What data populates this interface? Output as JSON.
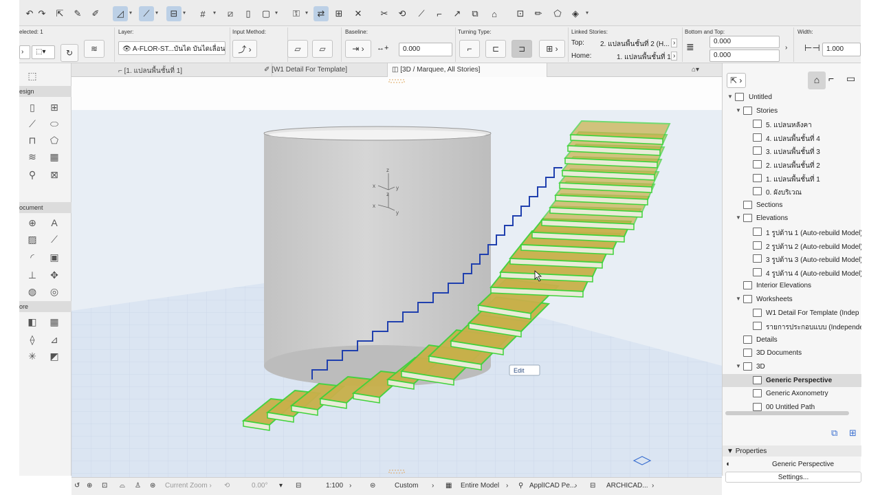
{
  "toolbar": {
    "icons": [
      "undo-icon",
      "redo-icon",
      "pick-icon",
      "eyedropper-icon",
      "inject-icon",
      "snap-guide-icon",
      "guide-line-icon",
      "gravity-icon",
      "grid-snap-icon",
      "trace-icon",
      "magic-wand-icon",
      "suspend-groups-icon",
      "lock-icon",
      "select-3d-icon",
      "cut-plane-icon",
      "orbit-icon",
      "trim-icon",
      "split-icon",
      "adjust-icon",
      "intersect-icon",
      "offset-icon",
      "resize-icon",
      "roof-icon",
      "layout-icon",
      "paint-icon",
      "section-icon",
      "explode-icon"
    ]
  },
  "infobox": {
    "selected_label": "elected: 1",
    "layer_label": "Layer:",
    "layer_value": "A-FLOR-ST...บันได บันไดเลื่อน",
    "input_method_label": "Input Method:",
    "baseline_label": "Baseline:",
    "baseline_value": "0.000",
    "turning_type_label": "Turning Type:",
    "linked_stories_label": "Linked Stories:",
    "top_label": "Top:",
    "top_value": "2. แปลนพื้นชั้นที่ 2 (H...",
    "home_label": "Home:",
    "home_value": "1. แปลนพื้นชั้นที่ 1",
    "bottom_top_label": "Bottom and Top:",
    "bottom_value": "0.000",
    "top_offset_value": "0.000",
    "width_label": "Width:",
    "width_value": "1.000"
  },
  "toolbox": {
    "sections": [
      "esign",
      "ocument",
      "ore"
    ]
  },
  "tabs": [
    {
      "label": "[1. แปลนพื้นชั้นที่ 1]"
    },
    {
      "label": "[W1 Detail For Template]"
    },
    {
      "label": "[3D / Marquee, All Stories]"
    }
  ],
  "viewport": {
    "edit_label": "Edit",
    "axis_labels": [
      "z",
      "x",
      "y",
      "z",
      "x",
      "y"
    ]
  },
  "navigator": {
    "root": "Untitled",
    "items": [
      {
        "label": "Stories",
        "level": 1
      },
      {
        "label": "5. แปลนหลังคา",
        "level": 2
      },
      {
        "label": "4. แปลนพื้นชั้นที่ 4",
        "level": 2
      },
      {
        "label": "3. แปลนพื้นชั้นที่ 3",
        "level": 2
      },
      {
        "label": "2. แปลนพื้นชั้นที่ 2",
        "level": 2
      },
      {
        "label": "1. แปลนพื้นชั้นที่ 1",
        "level": 2
      },
      {
        "label": "0. ผังบริเวณ",
        "level": 2
      },
      {
        "label": "Sections",
        "level": 1
      },
      {
        "label": "Elevations",
        "level": 1
      },
      {
        "label": "1 รูปด้าน 1 (Auto-rebuild Model)",
        "level": 2
      },
      {
        "label": "2 รูปด้าน 2 (Auto-rebuild Model)",
        "level": 2
      },
      {
        "label": "3 รูปด้าน 3 (Auto-rebuild Model)",
        "level": 2
      },
      {
        "label": "4 รูปด้าน 4 (Auto-rebuild Model)",
        "level": 2
      },
      {
        "label": "Interior Elevations",
        "level": 1
      },
      {
        "label": "Worksheets",
        "level": 1
      },
      {
        "label": "W1 Detail For Template (Indep",
        "level": 2
      },
      {
        "label": "รายการประกอบแบบ (Independe",
        "level": 2
      },
      {
        "label": "Details",
        "level": 1
      },
      {
        "label": "3D Documents",
        "level": 1
      },
      {
        "label": "3D",
        "level": 1
      },
      {
        "label": "Generic Perspective",
        "level": 2
      },
      {
        "label": "Generic Axonometry",
        "level": 2
      },
      {
        "label": "00 Untitled Path",
        "level": 2
      }
    ],
    "properties_label": "Properties",
    "properties_value": "Generic Perspective",
    "settings_label": "Settings..."
  },
  "statusbar": {
    "zoom_label": "Current Zoom",
    "angle_value": "0.00°",
    "scale_value": "1:100",
    "pen_set": "Custom",
    "model_filter": "Entire Model",
    "renovation": "ApplICAD Pe...",
    "dimension": "ARCHICAD..."
  },
  "colors": {
    "stair_fill": "#c8b04a",
    "stair_edge": "#3fd23a",
    "stringer": "#1f3fae",
    "cylinder": "#cfcfcf",
    "grid_floor": "#d9e4f1",
    "accent": "#bcd0e6"
  }
}
